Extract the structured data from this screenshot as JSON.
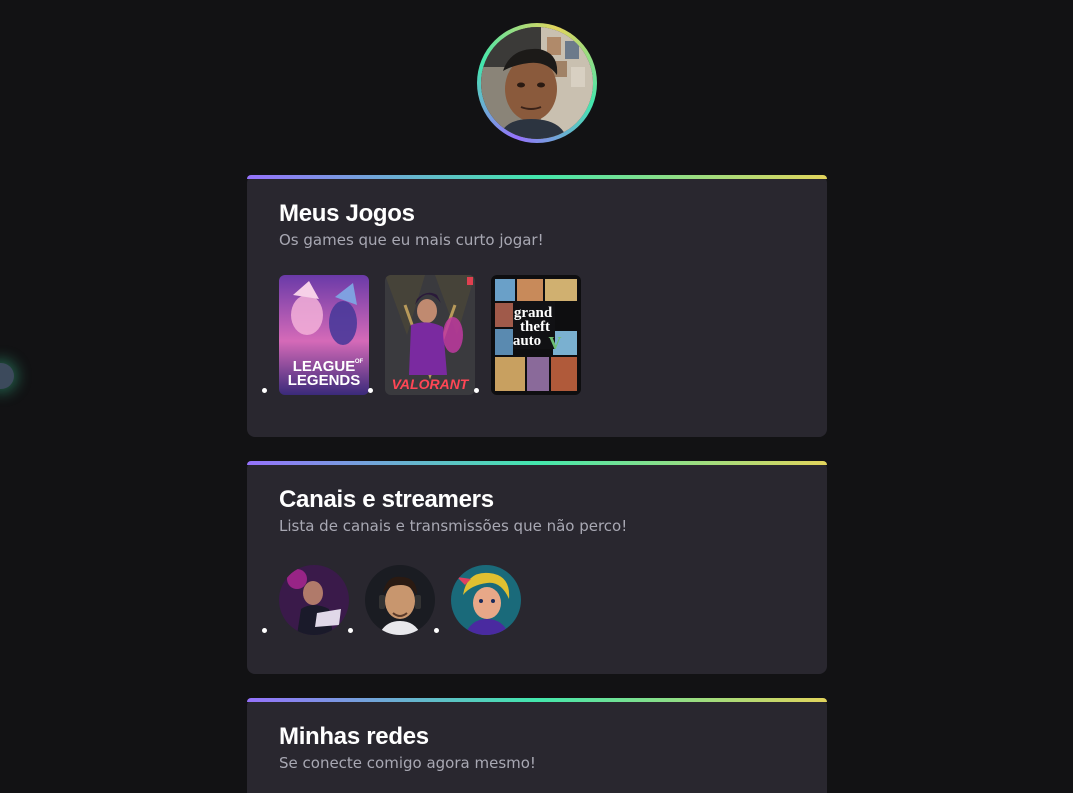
{
  "profile": {
    "avatar_icon": "profile-photo"
  },
  "games_section": {
    "title": "Meus Jogos",
    "subtitle": "Os games que eu mais curto jogar!",
    "games": [
      {
        "name": "League of Legends",
        "cover_line1": "LEAGUE",
        "cover_of": "OF",
        "cover_line2": "LEGENDS"
      },
      {
        "name": "Valorant",
        "cover_text": "VALORANT"
      },
      {
        "name": "Grand Theft Auto V",
        "cover_line1": "grand",
        "cover_line2": "theft",
        "cover_line3": "auto",
        "cover_numeral": "V"
      }
    ]
  },
  "streamers_section": {
    "title": "Canais e streamers",
    "subtitle": "Lista de canais e transmissões que não perco!",
    "streamers": [
      {
        "icon": "streamer-avatar-1"
      },
      {
        "icon": "streamer-avatar-2"
      },
      {
        "icon": "streamer-avatar-3"
      }
    ]
  },
  "social_section": {
    "title": "Minhas redes",
    "subtitle": "Se conecte comigo agora mesmo!"
  },
  "colors": {
    "background": "#121214",
    "card": "#29272f",
    "gradient_start": "#9572fc",
    "gradient_mid": "#43e7ad",
    "gradient_end": "#e2d45c"
  }
}
